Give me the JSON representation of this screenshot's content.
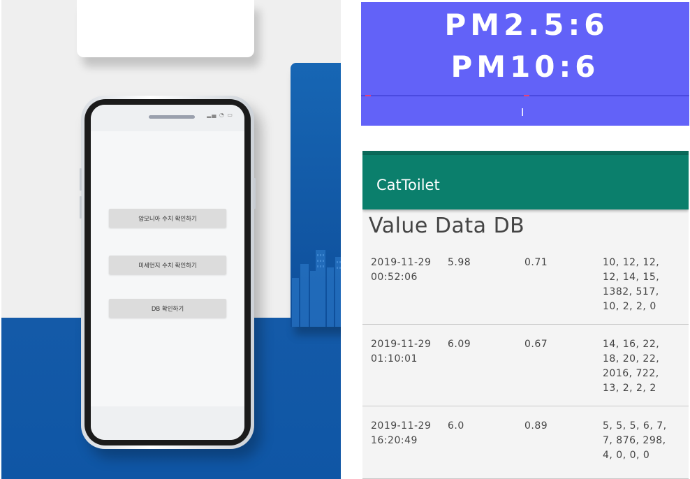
{
  "phone_menu": {
    "buttons": [
      {
        "label": "암모니아 수치 확인하기"
      },
      {
        "label": "미세먼지 수치 확인하기"
      },
      {
        "label": "DB 확인하기"
      }
    ]
  },
  "pm_display": {
    "pm25": "PM2.5:6",
    "pm10": "PM10:6",
    "cursor": "I"
  },
  "db_app": {
    "app_title": "CatToilet",
    "page_title": "Value Data DB",
    "rows": [
      {
        "date": "2019-11-29",
        "time": "00:52:06",
        "v1": "5.98",
        "v2": "0.71",
        "v3": [
          "10, 12, 12,",
          "12, 14, 15,",
          "1382, 517,",
          "10, 2, 2, 0"
        ]
      },
      {
        "date": "2019-11-29",
        "time": "01:10:01",
        "v1": "6.09",
        "v2": "0.67",
        "v3": [
          "14, 16, 22,",
          "18, 20, 22,",
          "2016, 722,",
          "13, 2, 2, 2"
        ]
      },
      {
        "date": "2019-11-29",
        "time": "16:20:49",
        "v1": "6.0",
        "v2": "0.89",
        "v3": [
          "5, 5, 5, 6, 7,",
          "7, 876, 298,",
          "4, 0, 0, 0"
        ]
      }
    ]
  },
  "colors": {
    "app_bar": "#0b7f6c",
    "pm_background": "#6262f8",
    "mockup_blue": "#0f56a5"
  }
}
